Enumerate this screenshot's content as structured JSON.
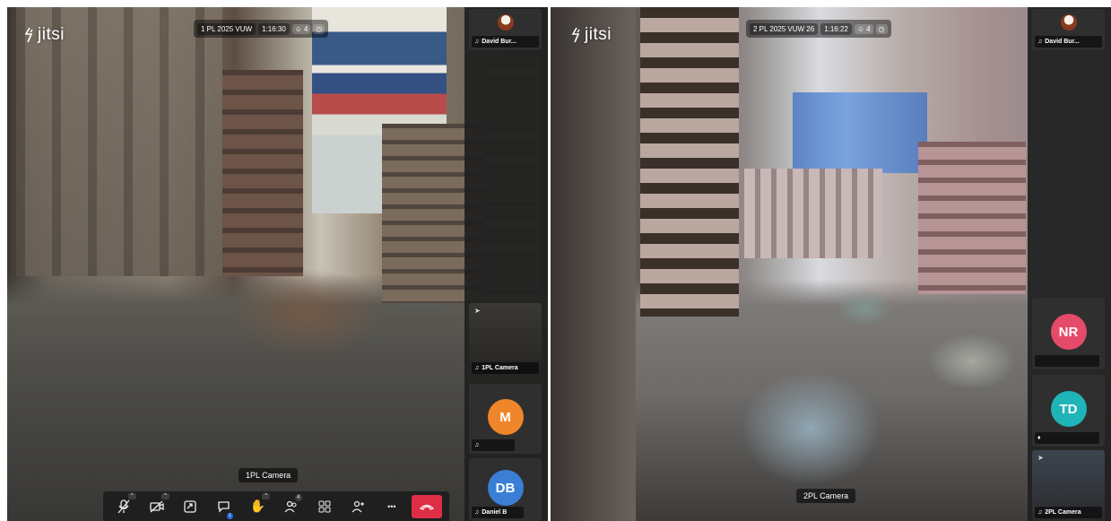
{
  "left": {
    "logo": "jitsi",
    "room": "1 PL 2025 VUW",
    "time": "1:16:30",
    "participant_count": "4",
    "stage_label": "1PL Camera",
    "tiles": [
      {
        "name": "David Bur...",
        "kind": "avatar-photo"
      },
      {
        "name": "1PL Camera",
        "kind": "camera"
      },
      {
        "name": "",
        "initials": "M",
        "color": "#f0862a"
      },
      {
        "name": "Daniel B",
        "initials": "DB",
        "color": "#3a7fd5"
      }
    ],
    "toolbar": {
      "mic": "mute-microphone",
      "camera": "stop-camera",
      "share": "share-screen",
      "chat": "open-chat",
      "chat_badge": "1",
      "raise_hand": "raise-hand",
      "participants": "participants",
      "participants_badge": "4",
      "tile_view": "tile-view",
      "invite": "invite",
      "more": "•••",
      "leave": "leave-meeting"
    }
  },
  "right": {
    "logo": "jitsi",
    "room": "2 PL 2025 VUW 26",
    "time": "1:16:22",
    "participant_count": "4",
    "stage_label": "2PL Camera",
    "tiles": [
      {
        "name": "David Bur...",
        "kind": "avatar-photo"
      },
      {
        "name": "",
        "initials": "NR",
        "color": "#e64a6a"
      },
      {
        "name": "",
        "initials": "TD",
        "color": "#1fb4b7"
      },
      {
        "name": "2PL Camera",
        "kind": "camera"
      }
    ]
  },
  "colors": {
    "hangup": "#dd2e45",
    "toolbar": "#1f1f1f",
    "filmstrip": "#202020"
  }
}
